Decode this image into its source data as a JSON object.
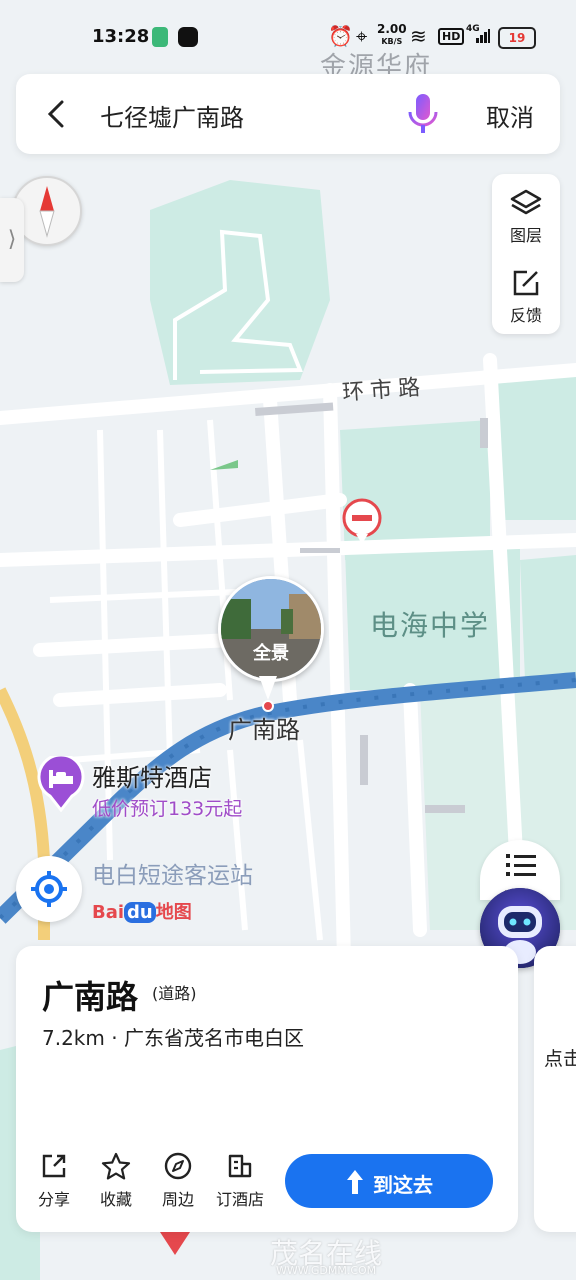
{
  "status_bar": {
    "time": "13:28",
    "net_speed_value": "2.00",
    "net_speed_unit": "KB/S",
    "hd": "HD",
    "signal_gen": "4G",
    "battery": "19",
    "icons": [
      "sim-icon",
      "tiktok-icon",
      "alarm-icon",
      "location-icon",
      "wifi-icon",
      "signal-icon",
      "battery-icon"
    ]
  },
  "search": {
    "query": "七径墟广南路",
    "cancel_label": "取消"
  },
  "map_tools": [
    {
      "label": "图层",
      "icon": "layers-icon"
    },
    {
      "label": "反馈",
      "icon": "feedback-icon"
    }
  ],
  "map_labels": {
    "top_partial": "金源华府",
    "ring_road": "环市路",
    "school": "电海中学",
    "road": "广南路",
    "hotel_name": "雅斯特酒店",
    "hotel_price": "低价预订133元起",
    "bus_station": "电白短途客运站",
    "baidu_brand": "Bai",
    "baidu_du": "du",
    "baidu_map": "地图"
  },
  "panorama": {
    "label": "全景"
  },
  "list_button": {
    "label": "列表"
  },
  "result_card": {
    "title": "广南路",
    "type": "(道路)",
    "info": "7.2km · 广东省茂名市电白区",
    "actions": [
      {
        "label": "分享",
        "icon": "share-icon"
      },
      {
        "label": "收藏",
        "icon": "star-icon"
      },
      {
        "label": "周边",
        "icon": "compass-icon"
      },
      {
        "label": "订酒店",
        "icon": "hotel-icon"
      }
    ],
    "go_label": "到这去"
  },
  "side_card": {
    "text": "点击"
  },
  "watermark": {
    "text": "茂名在线",
    "url": "WWW.GDMM.COM"
  },
  "colors": {
    "accent_blue": "#1a73f0",
    "road_blue": "#4a86c8",
    "hotel_purple": "#9b4fd6",
    "price_purple": "#a04cc8",
    "school_green": "#cdebe4"
  }
}
